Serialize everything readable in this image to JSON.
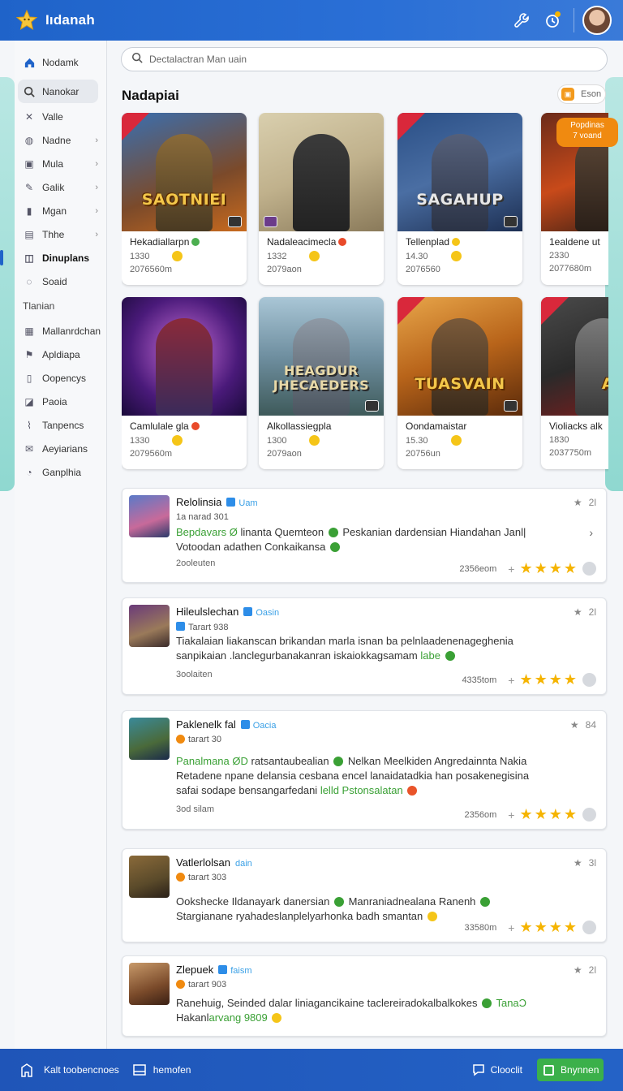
{
  "header": {
    "app_name": "Iıdanah"
  },
  "search": {
    "placeholder": "Dectalactran Man uain"
  },
  "sidebar": {
    "items": [
      {
        "label": "Nodamk",
        "icon": "home-icon"
      },
      {
        "label": "Nanokar",
        "icon": "search-icon"
      },
      {
        "label": "Valle",
        "icon": "sword-icon"
      },
      {
        "label": "Nadne",
        "icon": "globe-icon"
      },
      {
        "label": "Mula",
        "icon": "box-icon"
      },
      {
        "label": "Galik",
        "icon": "brush-icon"
      },
      {
        "label": "Mgan",
        "icon": "device-icon"
      },
      {
        "label": "Thhe",
        "icon": "book-icon"
      },
      {
        "label": "Dinuplans",
        "icon": "window-icon"
      },
      {
        "label": "Soaid",
        "icon": "chat-icon"
      }
    ],
    "section_label": "Tlanian",
    "section_items": [
      {
        "label": "Mallanrdchan",
        "icon": "grid-icon"
      },
      {
        "label": "Apldiapa",
        "icon": "flag-icon"
      },
      {
        "label": "Oopencys",
        "icon": "doc-icon"
      },
      {
        "label": "Paoia",
        "icon": "chart-icon"
      },
      {
        "label": "Tanpencs",
        "icon": "tag-icon"
      },
      {
        "label": "Aeyiarians",
        "icon": "mail-icon"
      },
      {
        "label": "Ganplhia",
        "icon": "pie-icon"
      }
    ]
  },
  "main": {
    "section_title": "Nadapiai",
    "toggle_label": "Eson",
    "promo_badge": "Popdinas\n7 voand",
    "cards": [
      {
        "name": "Hekadiallarpn",
        "count": "1330",
        "sub": "2076560m",
        "art": "SAOTNIEI",
        "tag": "g"
      },
      {
        "name": "Nadaleacimecla",
        "count": "1332",
        "sub": "2079aon",
        "art": "",
        "tag": "r"
      },
      {
        "name": "Tellenplad",
        "count": "14.30",
        "sub": "2076560",
        "art": "SAGAHUP",
        "tag": "y"
      },
      {
        "name": "1ealdene ut",
        "count": "2330",
        "sub": "2077680m",
        "art": "",
        "tag": ""
      },
      {
        "name": "Camlulale gla",
        "count": "1330",
        "sub": "2079560m",
        "art": "",
        "tag": "r"
      },
      {
        "name": "Alkollassiegpla",
        "count": "1300",
        "sub": "2079aon",
        "art": "HEAGDUR JHECAEDERS",
        "tag": ""
      },
      {
        "name": "Oondamaistar",
        "count": "15.30",
        "sub": "20756un",
        "art": "TUASVAIN",
        "tag": ""
      },
      {
        "name": "Violiacks alk",
        "count": "1830",
        "sub": "2037750m",
        "art": "ABS",
        "tag": ""
      }
    ],
    "reviews": [
      {
        "title": "Relolinsia",
        "vname": "Uam",
        "sub": "1a narad 301",
        "body_html": [
          "<span class=\"hl\">Bepdavars</span> <span class=\"hl\">Ø</span> linanta Quemteon <span class=\"ok\"></span> Peskanian dardensian Hiandahan Janl|",
          "Votoodan adathen Conkaikansa <span class=\"ok\"></span>"
        ],
        "time": "2ooleuten",
        "stat": "2356eom",
        "score": "2l"
      },
      {
        "title": "Hileulslechan",
        "vname": "Oasin",
        "sub": "Tarart 938",
        "body_html": [
          "Tiakalaian liakanscan brikandan marla isnan ba pelnlaadenenageghenia",
          "sanpikaian .lanclegurbanakanran iskaiokkagsamam <span class=\"hl\">labe</span> <span class=\"ok\"></span>"
        ],
        "time": "3oolaiten",
        "stat": "4335tom",
        "score": "2l"
      },
      {
        "title": "Paklenelk fal",
        "vname": "Oacia",
        "sub": "tarart 30",
        "body_html": [
          "<span class=\"hl\">Panalmana</span> <span class=\"hl\">ØD</span> ratsantaubealian <span class=\"ok\"></span> Nelkan Meelkiden Angredainnta Nakia",
          "Retadene npane delansia cesbana encel lanaidatadkia han posakenegisina",
          "safai sodape bensangarfedani <span class=\"hl\">lelld Pstonsalatan</span> <span class=\"em red\"></span>"
        ],
        "time": "3od silam",
        "stat": "2356om",
        "score": "84"
      },
      {
        "title": "Vatlerlolsan",
        "vname": "dain",
        "sub": "tarart 303",
        "body_html": [
          "Ookshecke Ildanayark danersian <span class=\"ok\"></span> Manraniadnealana Ranenh <span class=\"ok\"></span>",
          "Stargianane ryahadeslanplelyarhonka badh smantan <span class=\"em\"></span>"
        ],
        "time": "",
        "stat": "33580m",
        "score": "3l"
      },
      {
        "title": "Zlepuek",
        "vname": "faism",
        "sub": "tarart 903",
        "body_html": [
          "Ranehuig, Seinded dalar liniagancikaine taclereiradokalbalkokes <span class=\"ok\"></span> <span class=\"hl\">Tana</span><span class=\"hl\">Ɔ</span>",
          "Hakanl<span class=\"hl\">arvang 9809</span> <span class=\"em\"></span>"
        ],
        "time": "",
        "stat": "",
        "score": "2l"
      }
    ]
  },
  "bottombar": {
    "left_label": "Kalt toobencnoes",
    "mid_label": "hemofen",
    "right_label": "Clooclit",
    "primary_label": "Bnynnen"
  }
}
